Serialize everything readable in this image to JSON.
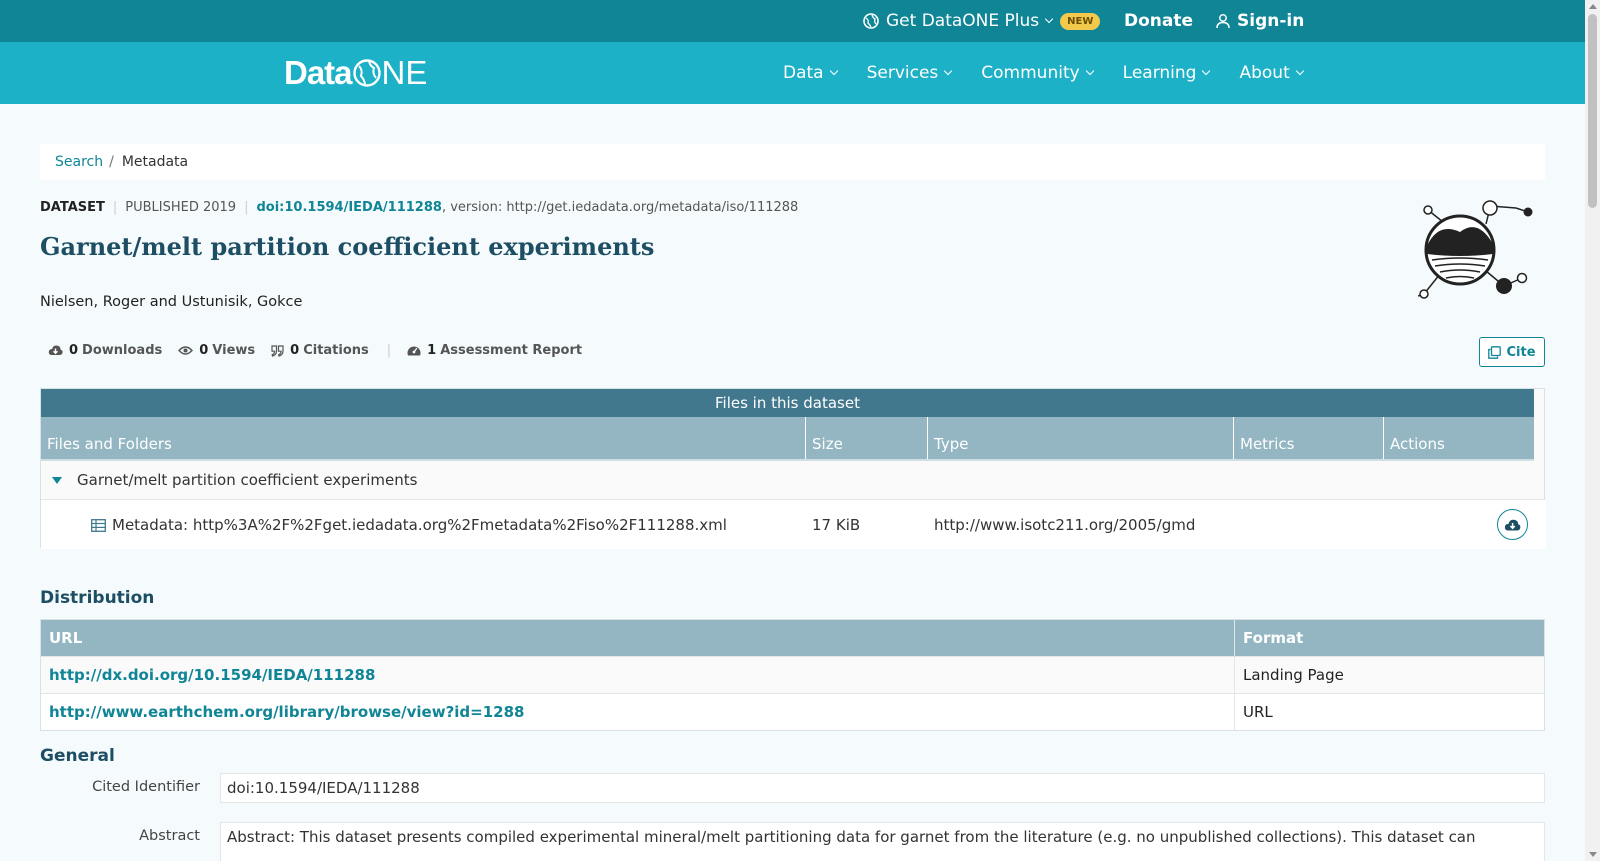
{
  "topbar": {
    "plus_label": "Get DataONE Plus",
    "new_badge": "NEW",
    "donate_label": "Donate",
    "signin_label": "Sign-in"
  },
  "nav": {
    "logo_data": "Data",
    "logo_one": "NE",
    "items": [
      "Data",
      "Services",
      "Community",
      "Learning",
      "About"
    ]
  },
  "breadcrumb": {
    "search": "Search",
    "separator": "/",
    "current": "Metadata"
  },
  "dataset": {
    "type": "DATASET",
    "published": "PUBLISHED 2019",
    "doi": "doi:10.1594/IEDA/111288",
    "version": ", version: http://get.iedadata.org/metadata/iso/111288",
    "title": "Garnet/melt partition coefficient experiments",
    "authors": "Nielsen, Roger and Ustunisik, Gokce"
  },
  "metrics": {
    "downloads_count": "0",
    "downloads_label": "Downloads",
    "views_count": "0",
    "views_label": "Views",
    "citations_count": "0",
    "citations_label": "Citations",
    "assessment_count": "1",
    "assessment_label": "Assessment Report",
    "cite_label": "Cite"
  },
  "files": {
    "header": "Files in this dataset",
    "columns": [
      "Files and Folders",
      "Size",
      "Type",
      "Metrics",
      "Actions"
    ],
    "folder_name": "Garnet/melt partition coefficient experiments",
    "file": {
      "name": "Metadata: http%3A%2F%2Fget.iedadata.org%2Fmetadata%2Fiso%2F111288.xml",
      "size": "17 KiB",
      "type": "http://www.isotc211.org/2005/gmd"
    }
  },
  "distribution": {
    "heading": "Distribution",
    "col_url": "URL",
    "col_format": "Format",
    "rows": [
      {
        "url": "http://dx.doi.org/10.1594/IEDA/111288",
        "format": "Landing Page"
      },
      {
        "url": "http://www.earthchem.org/library/browse/view?id=1288",
        "format": "URL"
      }
    ]
  },
  "general": {
    "heading": "General",
    "cited_identifier_label": "Cited Identifier",
    "cited_identifier": "doi:10.1594/IEDA/111288",
    "abstract_label": "Abstract",
    "abstract": "Abstract: This dataset presents compiled experimental mineral/melt partitioning data for garnet from the literature (e.g. no unpublished collections). This dataset can"
  },
  "colors": {
    "topbar": "#0f8596",
    "navbar": "#1db1c7",
    "accent": "#0f8596",
    "title": "#1d4e63",
    "table_header": "#41788e",
    "table_cols": "#93b6c2"
  }
}
